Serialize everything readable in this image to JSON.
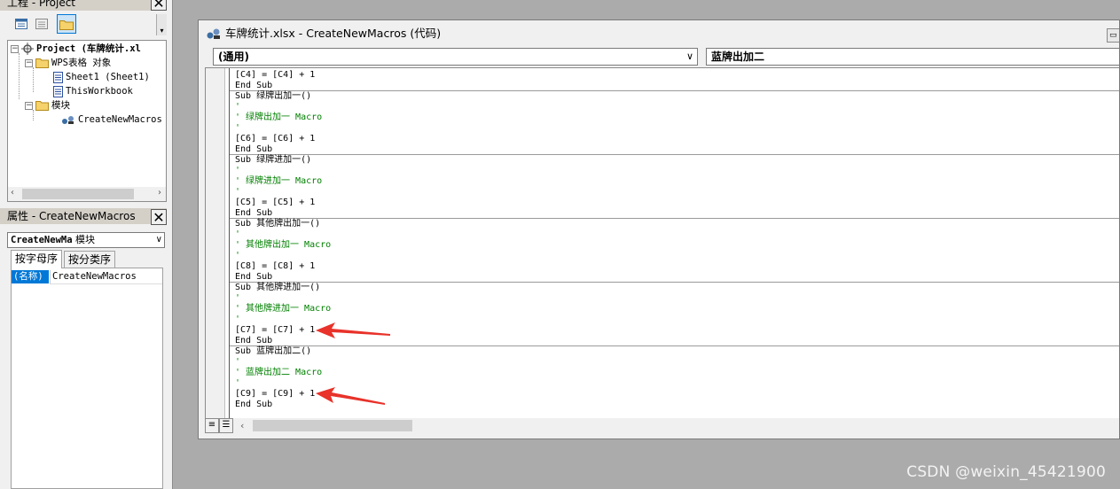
{
  "project_pane": {
    "title": "工程 - Project",
    "tree": {
      "root": "Project (车牌统计.xl",
      "objects_folder": "WPS表格 对象",
      "sheet1": "Sheet1 (Sheet1)",
      "workbook": "ThisWorkbook",
      "modules_folder": "模块",
      "module": "CreateNewMacros"
    }
  },
  "properties_pane": {
    "title": "属性 - CreateNewMacros",
    "object_combo_name": "CreateNewMa",
    "object_combo_type": "模块",
    "tabs": [
      "按字母序",
      "按分类序"
    ],
    "property_name": "(名称)",
    "property_value": "CreateNewMacros"
  },
  "code_window": {
    "title": "车牌统计.xlsx - CreateNewMacros (代码)",
    "object_combo": "(通用)",
    "proc_combo": "蓝牌出加二",
    "lines": [
      {
        "text": "[C4] = [C4] + 1",
        "type": "code"
      },
      {
        "text": "End Sub",
        "type": "code"
      },
      {
        "text": "Sub 绿牌出加一()",
        "type": "code"
      },
      {
        "text": "'",
        "type": "comment"
      },
      {
        "text": "' 绿牌出加一 Macro",
        "type": "comment"
      },
      {
        "text": "'",
        "type": "comment"
      },
      {
        "text": "[C6] = [C6] + 1",
        "type": "code"
      },
      {
        "text": "End Sub",
        "type": "code"
      },
      {
        "text": "Sub 绿牌进加一()",
        "type": "code"
      },
      {
        "text": "'",
        "type": "comment"
      },
      {
        "text": "' 绿牌进加一 Macro",
        "type": "comment"
      },
      {
        "text": "'",
        "type": "comment"
      },
      {
        "text": "[C5] = [C5] + 1",
        "type": "code"
      },
      {
        "text": "End Sub",
        "type": "code"
      },
      {
        "text": "Sub 其他牌出加一()",
        "type": "code"
      },
      {
        "text": "'",
        "type": "comment"
      },
      {
        "text": "' 其他牌出加一 Macro",
        "type": "comment"
      },
      {
        "text": "'",
        "type": "comment"
      },
      {
        "text": "[C8] = [C8] + 1",
        "type": "code"
      },
      {
        "text": "End Sub",
        "type": "code"
      },
      {
        "text": "Sub 其他牌进加一()",
        "type": "code"
      },
      {
        "text": "'",
        "type": "comment"
      },
      {
        "text": "' 其他牌进加一 Macro",
        "type": "comment"
      },
      {
        "text": "'",
        "type": "comment"
      },
      {
        "text": "[C7] = [C7] + 1",
        "type": "code"
      },
      {
        "text": "End Sub",
        "type": "code"
      },
      {
        "text": "Sub 蓝牌出加二()",
        "type": "code"
      },
      {
        "text": "'",
        "type": "comment"
      },
      {
        "text": "' 蓝牌出加二 Macro",
        "type": "comment"
      },
      {
        "text": "'",
        "type": "comment"
      },
      {
        "text": "[C9] = [C9] + 1",
        "type": "code"
      },
      {
        "text": "End Sub",
        "type": "code"
      }
    ]
  },
  "watermark": "CSDN @weixin_45421900",
  "colors": {
    "comment": "#008000",
    "selection": "#0078d7",
    "annotation_arrow": "#e8322a",
    "mdi_background": "#ababab"
  }
}
